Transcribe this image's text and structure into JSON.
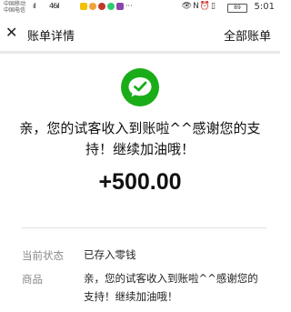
{
  "status_bar": {
    "carrier_1": "中国移动",
    "carrier_2": "中国电信",
    "signal_1": "ıl",
    "signal_2": "46ıl",
    "battery": "89",
    "time": "5:01"
  },
  "nav": {
    "title": "账单详情",
    "right_link": "全部账单"
  },
  "transaction": {
    "description": "亲，您的试客收入到账啦^^感谢您的支持！继续加油哦！",
    "amount": "+500.00"
  },
  "details": {
    "status_label": "当前状态",
    "status_value": "已存入零钱",
    "product_label": "商品",
    "product_value": "亲，您的试客收入到账啦^^感谢您的支持！继续加油哦！"
  },
  "colors": {
    "wechat_green": "#1aad19",
    "label_gray": "#8a8a8a"
  }
}
